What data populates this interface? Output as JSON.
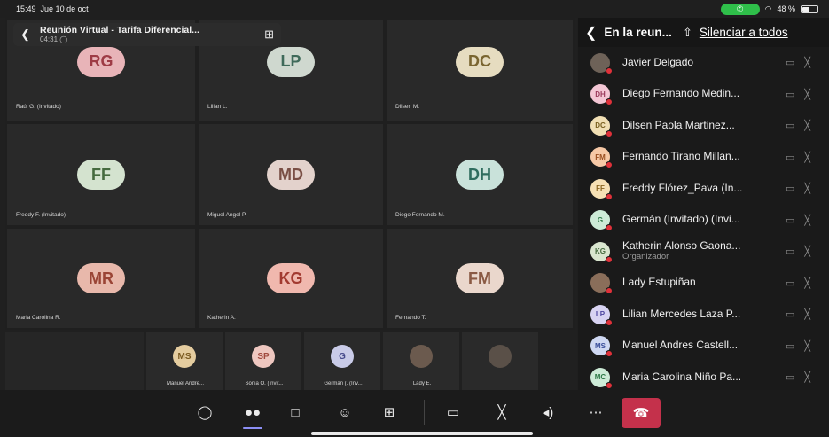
{
  "status_bar": {
    "time": "15:49",
    "date": "Jue 10 de oct",
    "battery": "48 %",
    "battery_level": 0.48,
    "wifi_icon": "wifi-icon",
    "call_icon": "phone-icon"
  },
  "meeting": {
    "title": "Reunión Virtual - Tarifa Diferencial...",
    "elapsed": "04:31"
  },
  "tiles": [
    {
      "initials": "RG",
      "name": "Raúl G. (Invitado)",
      "bg": "#e8b4b8",
      "fg": "#9e3b45"
    },
    {
      "initials": "LP",
      "name": "Lilian L.",
      "bg": "#cfd8cf",
      "fg": "#3f6a5a"
    },
    {
      "initials": "DC",
      "name": "Dilsen M.",
      "bg": "#e6dcc0",
      "fg": "#7a6530"
    },
    {
      "initials": "FF",
      "name": "Freddy F. (Invitado)",
      "bg": "#d4e3cf",
      "fg": "#466b3f"
    },
    {
      "initials": "MD",
      "name": "Miguel Angel P.",
      "bg": "#e3d2cc",
      "fg": "#7a4f45"
    },
    {
      "initials": "DH",
      "name": "Diego Fernando M.",
      "bg": "#c9e2da",
      "fg": "#2f6d5e"
    },
    {
      "initials": "MR",
      "name": "Maria Carolina R.",
      "bg": "#e8b8ab",
      "fg": "#9a4435"
    },
    {
      "initials": "KG",
      "name": "Katherin A.",
      "bg": "#f0b8ae",
      "fg": "#a23a30"
    },
    {
      "initials": "FM",
      "name": "Fernando T.",
      "bg": "#ead7cc",
      "fg": "#8a5a44"
    }
  ],
  "strip": [
    {
      "initials": "MS",
      "name": "Manuel Andre...",
      "bg": "#e4cc9f",
      "fg": "#7a5a20"
    },
    {
      "initials": "SP",
      "name": "Sonia O. (Invit...",
      "bg": "#eec7c0",
      "fg": "#a04a3e"
    },
    {
      "initials": "G",
      "name": "Germán (. (Inv...",
      "bg": "#c9cbe8",
      "fg": "#45498a"
    },
    {
      "initials": "",
      "name": "Lady E.",
      "bg": "#6b5a4e",
      "fg": "#fff"
    },
    {
      "initials": "",
      "name": "",
      "bg": "#5a5048",
      "fg": "#fff"
    }
  ],
  "panel": {
    "title": "En la reun...",
    "mute_all": "Silenciar a todos",
    "participants": [
      {
        "initials": "",
        "name": "Javier Delgado",
        "role": "",
        "bg": "#6e6258",
        "fg": "#fff"
      },
      {
        "initials": "DH",
        "name": "Diego Fernando Medin...",
        "role": "",
        "bg": "#f3c6d4",
        "fg": "#9a3b5c"
      },
      {
        "initials": "DC",
        "name": "Dilsen Paola Martinez...",
        "role": "",
        "bg": "#f1dfb4",
        "fg": "#7a6020"
      },
      {
        "initials": "FM",
        "name": "Fernando Tirano Millan...",
        "role": "",
        "bg": "#f6c8a6",
        "fg": "#9a4e20"
      },
      {
        "initials": "FF",
        "name": "Freddy Flórez_Pava (In...",
        "role": "",
        "bg": "#f6e0b4",
        "fg": "#8a6520"
      },
      {
        "initials": "G",
        "name": "Germán (Invitado) (Invi...",
        "role": "",
        "bg": "#cdebd7",
        "fg": "#2f7a48"
      },
      {
        "initials": "KG",
        "name": "Katherin Alonso Gaona...",
        "role": "Organizador",
        "bg": "#d9e6cf",
        "fg": "#466b3f"
      },
      {
        "initials": "",
        "name": "Lady Estupiñan",
        "role": "",
        "bg": "#8a6e5a",
        "fg": "#fff"
      },
      {
        "initials": "LP",
        "name": "Lilian Mercedes Laza P...",
        "role": "",
        "bg": "#d8d3f2",
        "fg": "#4e46a0"
      },
      {
        "initials": "MS",
        "name": "Manuel Andres Castell...",
        "role": "",
        "bg": "#cfd8f2",
        "fg": "#3a4e9a"
      },
      {
        "initials": "MC",
        "name": "Maria Carolina Niño Pa...",
        "role": "",
        "bg": "#cdebd7",
        "fg": "#2f7a48"
      }
    ]
  },
  "toolbar": {
    "icons": [
      "chat-icon",
      "people-icon",
      "share-screen-icon",
      "reactions-icon",
      "apps-icon",
      "camera-off-icon",
      "mic-off-icon",
      "speaker-icon",
      "more-icon",
      "leave-call-icon"
    ],
    "accent": "#8c8ff5",
    "leave_color": "#c4314b"
  }
}
